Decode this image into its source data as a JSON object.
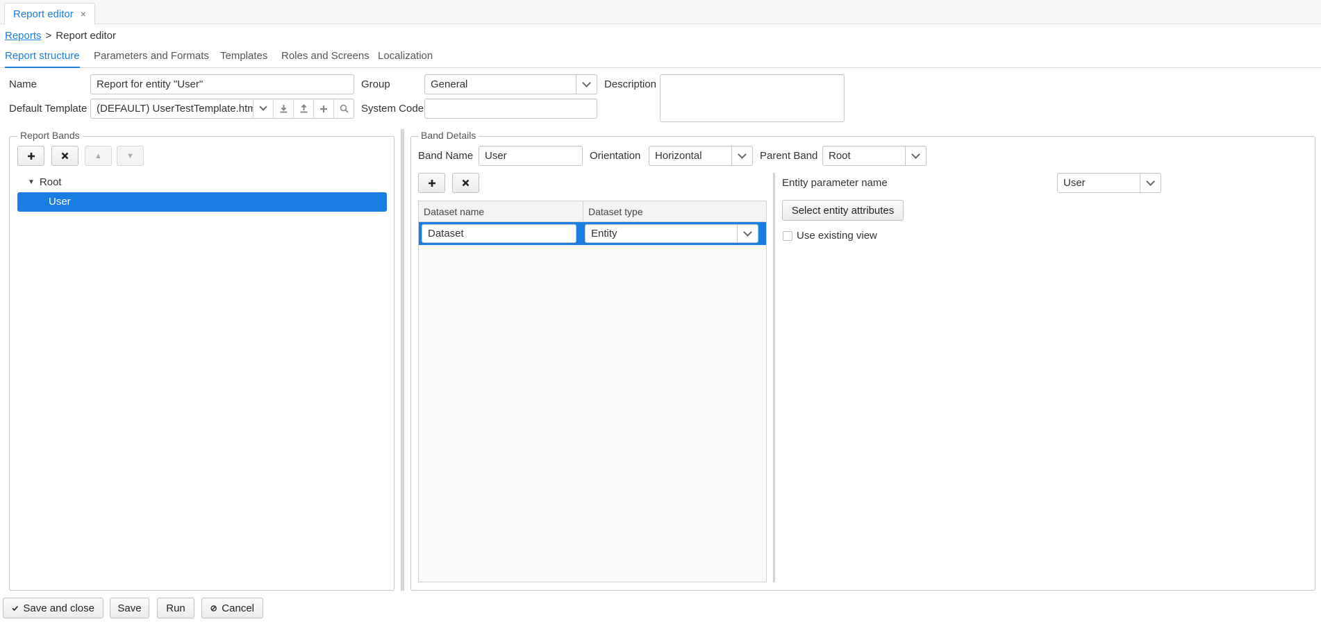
{
  "window_tab": {
    "title": "Report editor",
    "close": "×"
  },
  "breadcrumb": {
    "parent": "Reports",
    "separator": ">",
    "current": "Report editor"
  },
  "tabs": [
    "Report structure",
    "Parameters and Formats",
    "Templates",
    "Roles and Screens",
    "Localization"
  ],
  "form": {
    "name_label": "Name",
    "name_value": "Report for entity \"User\"",
    "group_label": "Group",
    "group_value": "General",
    "description_label": "Description",
    "description_value": "",
    "default_template_label": "Default Template",
    "default_template_value": "(DEFAULT) UserTestTemplate.html",
    "system_code_label": "System Code",
    "system_code_value": ""
  },
  "report_bands": {
    "title": "Report Bands",
    "tree": [
      {
        "label": "Root",
        "expanded": true
      },
      {
        "label": "User",
        "selected": true
      }
    ]
  },
  "band_details": {
    "title": "Band Details",
    "band_name_label": "Band Name",
    "band_name_value": "User",
    "orientation_label": "Orientation",
    "orientation_value": "Horizontal",
    "parent_band_label": "Parent Band",
    "parent_band_value": "Root",
    "dataset_columns": [
      "Dataset name",
      "Dataset type"
    ],
    "dataset_rows": [
      {
        "name": "Dataset",
        "type": "Entity"
      }
    ],
    "entity_param_label": "Entity parameter name",
    "entity_param_value": "User",
    "select_attributes_label": "Select entity attributes",
    "use_existing_view_label": "Use existing view",
    "use_existing_view_checked": false
  },
  "footer": {
    "save_close": "Save and close",
    "save": "Save",
    "run": "Run",
    "cancel": "Cancel"
  },
  "colors": {
    "accent": "#197de1",
    "border": "#c5c5c5"
  }
}
